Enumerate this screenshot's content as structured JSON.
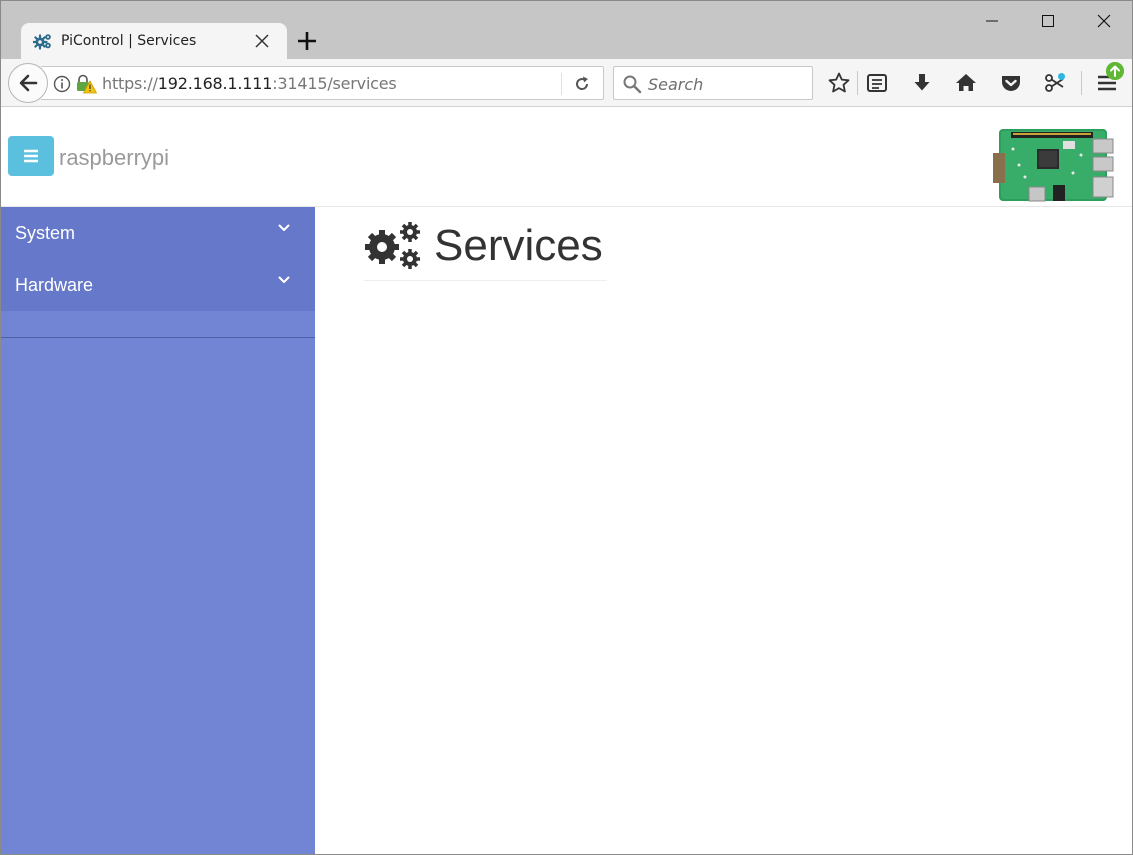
{
  "browser": {
    "tab_title": "PiControl | Services",
    "url_scheme": "https://",
    "url_host": "192.168.1.111",
    "url_rest": ":31415/services",
    "search_placeholder": "Search"
  },
  "app": {
    "brand": "raspberrypi",
    "accent_color": "#5bc0de",
    "sidebar_color": "#7284d4"
  },
  "sidebar": {
    "items": [
      {
        "label": "System"
      },
      {
        "label": "Hardware"
      }
    ]
  },
  "main": {
    "title": "Services"
  }
}
